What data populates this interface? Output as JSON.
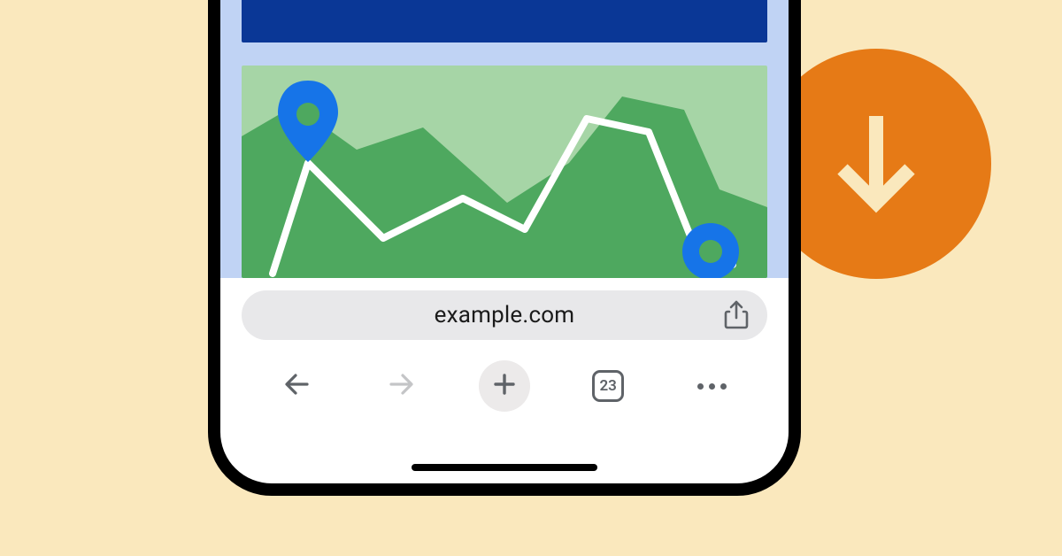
{
  "badge": {
    "icon_name": "download-icon"
  },
  "browser": {
    "url": "example.com",
    "share_icon": "share-icon",
    "toolbar": {
      "back_icon": "back-icon",
      "forward_icon": "forward-icon",
      "new_tab_icon": "plus-icon",
      "tabs_count": "23",
      "more_icon": "more-icon"
    }
  },
  "map": {
    "pin_a": "location-pin-icon",
    "pin_b": "location-dot-icon"
  },
  "colors": {
    "bg": "#fae8bd",
    "badge": "#e67a16",
    "blue_bar": "#0a3796",
    "page_bg": "#c0d3f4",
    "map_light": "#a6d5a6",
    "map_dark": "#4ea85f",
    "pin": "#1674e8",
    "omnibox": "#e8e8ea",
    "toolbar_icon": "#5f6368"
  }
}
